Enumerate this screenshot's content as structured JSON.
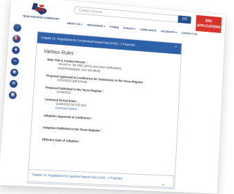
{
  "header": {
    "logo_text": "TEXAS RAILROAD COMMISSION",
    "search_placeholder": "Contact Search",
    "go_label": "GO",
    "apps_button_line1": "RRC",
    "apps_button_line2": "APPLICATIONS"
  },
  "nav": [
    "ABOUT US ▾",
    "RESOURCES ▾",
    "FORMS",
    "EVENTS ▾",
    "COMPLAINTS",
    "ACCIDENTS ▾",
    "CONTACT US"
  ],
  "sidebar_icons": [
    "info-icon",
    "gas-pump-icon",
    "car-icon",
    "pipeline-icon",
    "oil-icon",
    "globe-icon",
    "truck-icon"
  ],
  "panel": {
    "title": "Chapter 13. Regulations for Compressed Natural Gas (CNG) - 1 Proposed",
    "section_title": "Various Rules",
    "rules": [
      {
        "label": "Rule Title & Contact Person :",
        "values": [
          "Amend re: SB 1582 (2021) and other clarifications",
          "(April Richardson, 512-463-6935)"
        ],
        "link": false
      },
      {
        "label": "Proposal Approved at Conference for Submission to the Texas Register :",
        "values": [
          "10/11/2022 (pdf format)"
        ],
        "link": false
      },
      {
        "label": "Proposal Published in the Texas Register :",
        "values": [
          "10/28/2022"
        ],
        "link": false
      },
      {
        "label": "Comment Period Ends :",
        "values": [
          "11/28/2022 (at 5:00 pm)"
        ],
        "link_text": "Comment Online",
        "link": true
      },
      {
        "label": "Adoption Approved at Conference :",
        "values": [
          "--"
        ],
        "link": false
      },
      {
        "label": "Adoption Published in the Texas Register :",
        "values": [
          "--"
        ],
        "link": false
      },
      {
        "label": "Effective Date of Adoption :",
        "values": [
          "--"
        ],
        "link": false
      }
    ]
  },
  "panel2": {
    "title": "Chapter 14. Regulations for Liquefied Natural Gas (LNG) - 1 Proposed"
  },
  "colors": {
    "primary": "#2f61a8",
    "accent": "#d9342b",
    "nav": "#1f3a6e"
  }
}
